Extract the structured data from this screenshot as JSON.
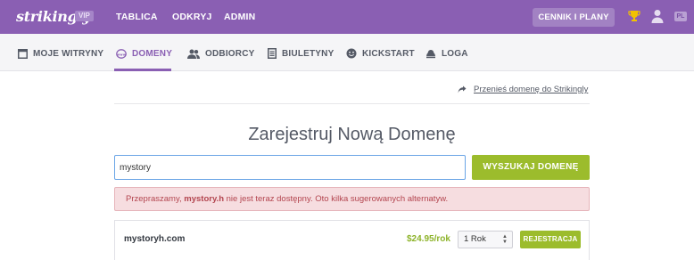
{
  "header": {
    "logo": "strikingly",
    "badge": "VIP",
    "nav": [
      "TABLICA",
      "ODKRYJ",
      "ADMIN"
    ],
    "pricing_button": "CENNIK I PLANY",
    "lang": "PL"
  },
  "subnav": {
    "items": [
      "MOJE WITRYNY",
      "DOMENY",
      "ODBIORCY",
      "BIULETYNY",
      "KICKSTART",
      "LOGA"
    ],
    "active": "DOMENY"
  },
  "transfer_link": "Przenieś domenę do Strikingly",
  "title": "Zarejestruj Nową Domenę",
  "search": {
    "value": "mystory",
    "button": "WYSZUKAJ DOMENĘ"
  },
  "alert": {
    "prefix": "Przepraszamy, ",
    "domain": "mystory.h",
    "suffix": " nie jest teraz dostępny. Oto kilka sugerowanych alternatyw."
  },
  "results": [
    {
      "domain": "mystoryh.com",
      "price": "$24.95/rok",
      "period": "1 Rok",
      "button": "REJESTRACJA"
    }
  ],
  "colors": {
    "brand": "#8a5fb3",
    "accent_green": "#9cbc2c",
    "alert_bg": "#f6dde0",
    "alert_text": "#b3454f"
  }
}
